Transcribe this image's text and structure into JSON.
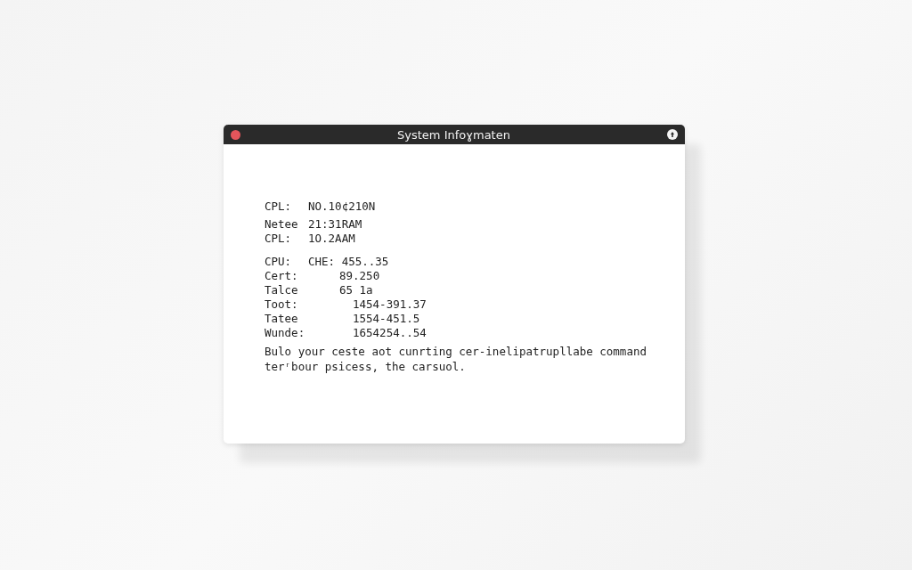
{
  "window": {
    "title": "System Infoɣmaten"
  },
  "groups": [
    {
      "rows": [
        {
          "label": "CPL:",
          "value": "NO.10¢210N"
        }
      ]
    },
    {
      "rows": [
        {
          "label": "Netee",
          "value": "21:31RAM"
        },
        {
          "label": "CPL:",
          "value": "1O.2ΑAM"
        }
      ]
    },
    {
      "rows": [
        {
          "label": "CPU:",
          "value": "CHE: 455..35"
        }
      ]
    },
    {
      "rows": [
        {
          "label": "Cert:",
          "value": "89.250"
        },
        {
          "label": "Talce",
          "value": "65 1a"
        }
      ]
    },
    {
      "rows": [
        {
          "label": "Toot:",
          "value": "1454-391.37"
        },
        {
          "label": "Tatee",
          "value": "1554-451.5"
        },
        {
          "label": "Wunde:",
          "value": "1654254..54"
        }
      ]
    }
  ],
  "message": "Bulo your ceste aot cunrting cer-inelipatrupllabe command terʳbour psicess, the carsuol."
}
